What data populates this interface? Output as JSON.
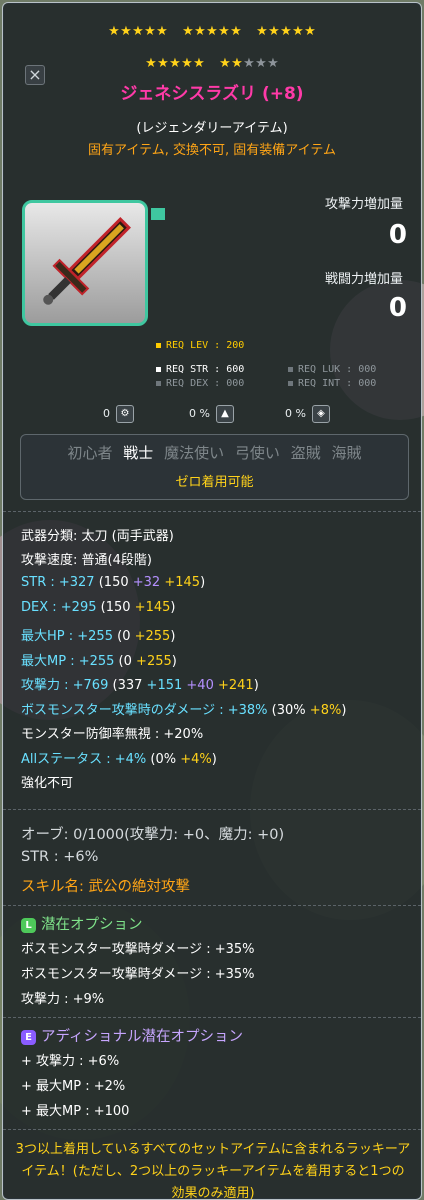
{
  "stars": {
    "rows": [
      [
        [
          5,
          0
        ],
        [
          5,
          0
        ],
        [
          5,
          0
        ]
      ],
      [
        [
          5,
          0
        ],
        [
          2,
          3
        ]
      ]
    ],
    "filled": 22,
    "total": 25,
    "colors": {
      "on": "#ffd21a",
      "off": "#8d949a"
    }
  },
  "close_button": {
    "glyph": "×"
  },
  "item": {
    "name": "ジェネシスラズリ (+8)",
    "grade": "(レジェンダリーアイテム)",
    "flags": "固有アイテム, 交換不可, 固有装備アイテム",
    "name_color": "#ff3aa8"
  },
  "compare": {
    "attack_label": "攻撃力増加量",
    "attack_value": "0",
    "combat_label": "戦闘力増加量",
    "combat_value": "0"
  },
  "requirements": {
    "lev": "REQ LEV : 200",
    "str": "REQ STR : 600",
    "luk": "REQ LUK : 000",
    "dex": "REQ DEX : 000",
    "int": "REQ INT : 000"
  },
  "indicators": [
    {
      "label": "0",
      "icon": "gear-icon"
    },
    {
      "label": "0 %",
      "icon": "anvil-icon"
    },
    {
      "label": "0 %",
      "icon": "shield-icon"
    }
  ],
  "jobs": {
    "items": [
      "初心者",
      "戦士",
      "魔法使い",
      "弓使い",
      "盗賊",
      "海賊"
    ],
    "active_index": 1,
    "note": "ゼロ着用可能"
  },
  "stats": {
    "weapon_type": "武器分類: 太刀 (両手武器)",
    "attack_speed": "攻撃速度: 普通(4段階)",
    "str": {
      "label": "STR : +327",
      "base": "150",
      "scroll": "+32",
      "star": "+145"
    },
    "dex": {
      "label": "DEX : +295",
      "base": "150",
      "star": "+145"
    },
    "max_hp": {
      "label": "最大HP : +255",
      "base": "0",
      "star": "+255"
    },
    "max_mp": {
      "label": "最大MP : +255",
      "base": "0",
      "star": "+255"
    },
    "attack": {
      "label": "攻撃力 : +769",
      "base": "337",
      "bonus": "+151",
      "scroll": "+40",
      "star": "+241"
    },
    "boss_damage": {
      "label": "ボスモンスター攻撃時のダメージ : +38%",
      "base": "30%",
      "star": "+8%"
    },
    "ignore_def": "モンスター防御率無視 : +20%",
    "all_stat": {
      "label": "Allステータス : +4%",
      "base": "0%",
      "star": "+4%"
    },
    "no_enhance": "強化不可"
  },
  "extra": {
    "orb": "オーブ: 0/1000(攻撃力: +0、魔力: +0)",
    "str": "STR : +6%",
    "skill": "スキル名: 武公の絶対攻撃"
  },
  "potential": {
    "badge": "L",
    "title": "潜在オプション",
    "lines": [
      "ボスモンスター攻撃時ダメージ : +35%",
      "ボスモンスター攻撃時ダメージ : +35%",
      "攻撃力 : +9%"
    ]
  },
  "additional_potential": {
    "badge": "E",
    "title": "アディショナル潜在オプション",
    "lines": [
      "+ 攻撃力 : +6%",
      "+ 最大MP : +2%",
      "+ 最大MP : +100"
    ]
  },
  "set_text": "3つ以上着用しているすべてのセットアイテムに含まれるラッキーアイテム！(ただし、2つ以上のラッキーアイテムを着用すると1つの効果のみ適用)"
}
